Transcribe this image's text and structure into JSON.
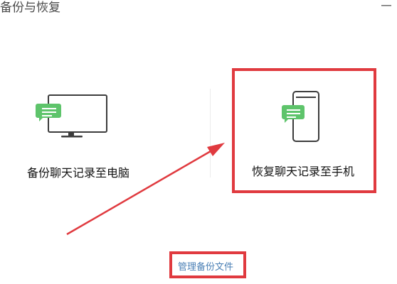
{
  "window": {
    "title": "备份与恢复"
  },
  "options": {
    "backup_to_pc": "备份聊天记录至电脑",
    "restore_to_phone": "恢复聊天记录至手机"
  },
  "links": {
    "manage_backup": "管理备份文件"
  },
  "icons": {
    "computer": "computer-chat-icon",
    "phone": "phone-chat-icon"
  },
  "colors": {
    "highlight": "#e03a3f",
    "chat_bubble": "#5ec46b",
    "link": "#4a7fb5"
  }
}
